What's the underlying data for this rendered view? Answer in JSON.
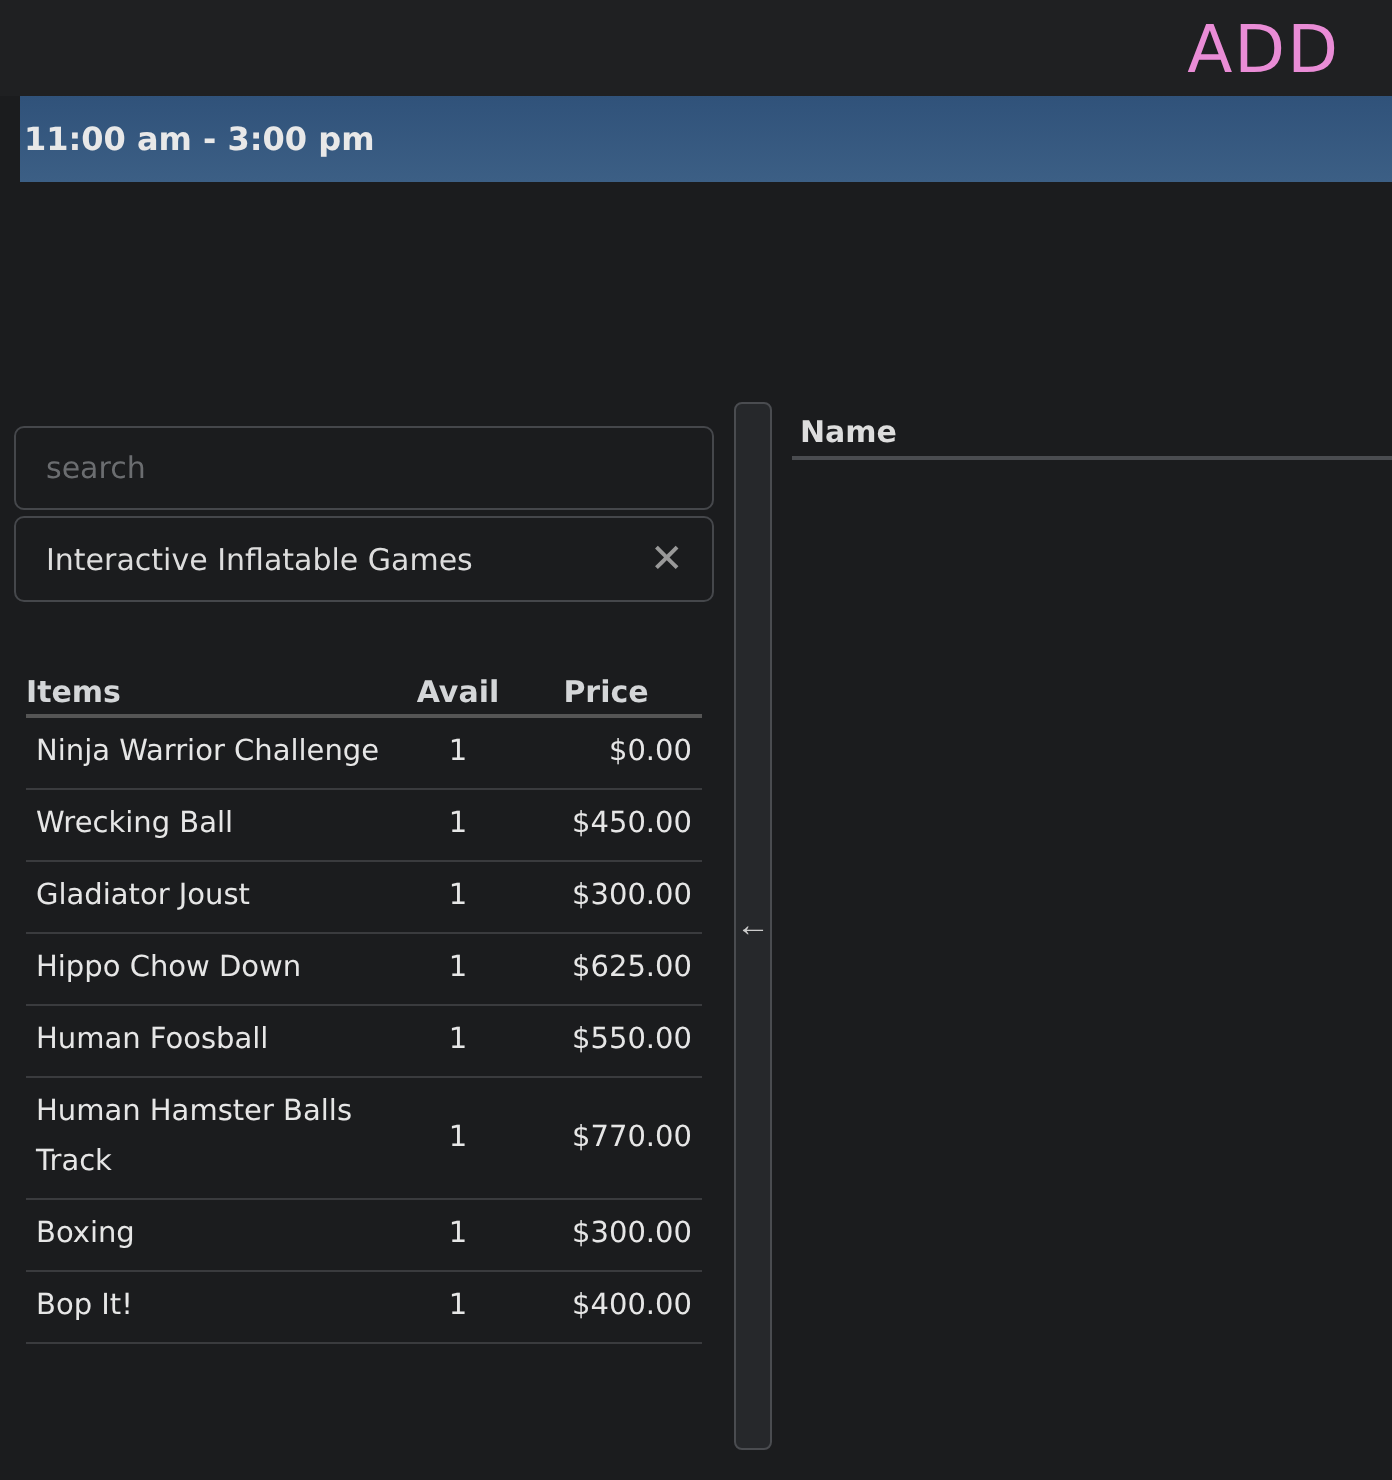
{
  "header": {
    "title": "ADD"
  },
  "event": {
    "time": "11:00 am - 3:00 pm"
  },
  "search": {
    "placeholder": "search"
  },
  "category_filter": {
    "value": "Interactive Inflatable Games",
    "clear": "✕"
  },
  "items_table": {
    "columns": [
      "Items",
      "Avail",
      "Price"
    ],
    "rows": [
      {
        "name": "Ninja Warrior Challenge",
        "avail": "1",
        "price": "$0.00"
      },
      {
        "name": "Wrecking Ball",
        "avail": "1",
        "price": "$450.00"
      },
      {
        "name": "Gladiator Joust",
        "avail": "1",
        "price": "$300.00"
      },
      {
        "name": "Hippo Chow Down",
        "avail": "1",
        "price": "$625.00"
      },
      {
        "name": "Human Foosball",
        "avail": "1",
        "price": "$550.00"
      },
      {
        "name": "Human Hamster Balls Track",
        "avail": "1",
        "price": "$770.00"
      },
      {
        "name": "Boxing",
        "avail": "1",
        "price": "$300.00"
      },
      {
        "name": "Bop It!",
        "avail": "1",
        "price": "$400.00"
      }
    ]
  },
  "transfer": {
    "arrow": "←"
  },
  "selected_table": {
    "columns": [
      "Name"
    ]
  }
}
